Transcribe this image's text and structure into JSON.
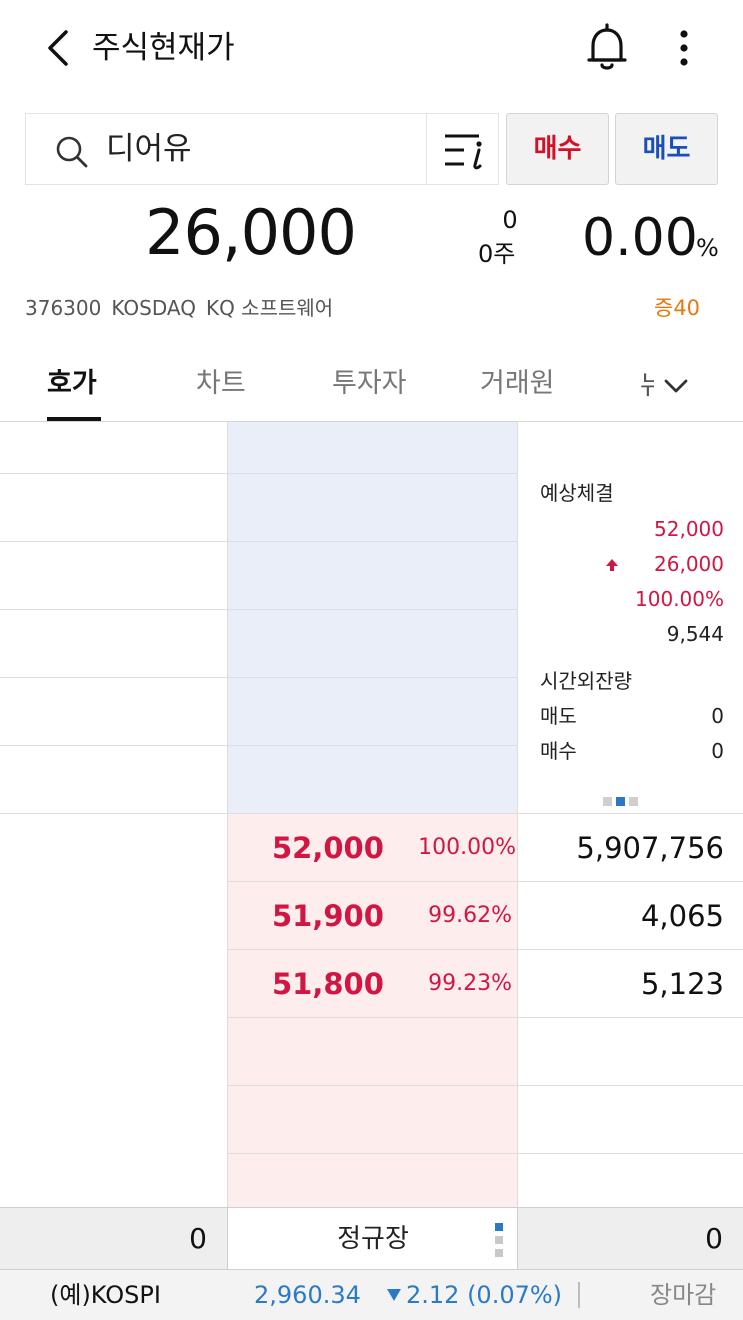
{
  "header": {
    "title": "주식현재가",
    "icons": {
      "back": "chevron-left-icon",
      "notification": "bell-icon",
      "more": "more-vertical-icon"
    }
  },
  "search": {
    "value": "디어유",
    "icon": "search-icon",
    "list_icon": "list-info-icon"
  },
  "actions": {
    "buy_label": "매수",
    "sell_label": "매도",
    "buy_color": "#d60f25",
    "sell_color": "#1a4fb5"
  },
  "quote": {
    "price": "26,000",
    "change_amount": "0",
    "volume": "0주",
    "change_rate": "0.00",
    "percent_sign": "%",
    "code": "376300",
    "market": "KOSDAQ",
    "sector": "KQ 소프트웨어",
    "margin_badge": "증40",
    "margin_color": "#e8770e"
  },
  "tabs": [
    {
      "label": "호가",
      "active": true
    },
    {
      "label": "차트",
      "active": false
    },
    {
      "label": "투자자",
      "active": false
    },
    {
      "label": "거래원",
      "active": false
    },
    {
      "label": "뉴",
      "active": false
    }
  ],
  "order_book": {
    "bids": [
      {
        "price": "52,000",
        "rate": "100.00%",
        "qty": "5,907,756"
      },
      {
        "price": "51,900",
        "rate": "99.62%",
        "qty": "4,065"
      },
      {
        "price": "51,800",
        "rate": "99.23%",
        "qty": "5,123"
      }
    ],
    "bid_color": "#d01744"
  },
  "side_panel": {
    "expected_title": "예상체결",
    "expected_price": "52,000",
    "expected_change": "26,000",
    "expected_rate": "100.00%",
    "expected_volume": "9,544",
    "after_hours_title": "시간외잔량",
    "after_sell_label": "매도",
    "after_sell_value": "0",
    "after_buy_label": "매수",
    "after_buy_value": "0",
    "page_index": 2,
    "page_count": 3
  },
  "summary": {
    "total_ask": "0",
    "session": "정규장",
    "total_bid": "0"
  },
  "ticker": {
    "index_name": "(예)KOSPI",
    "index_value": "2,960.34",
    "index_change": "2.12 (0.07%)",
    "direction": "down",
    "status": "장마감",
    "color": "#2b7ac6"
  }
}
